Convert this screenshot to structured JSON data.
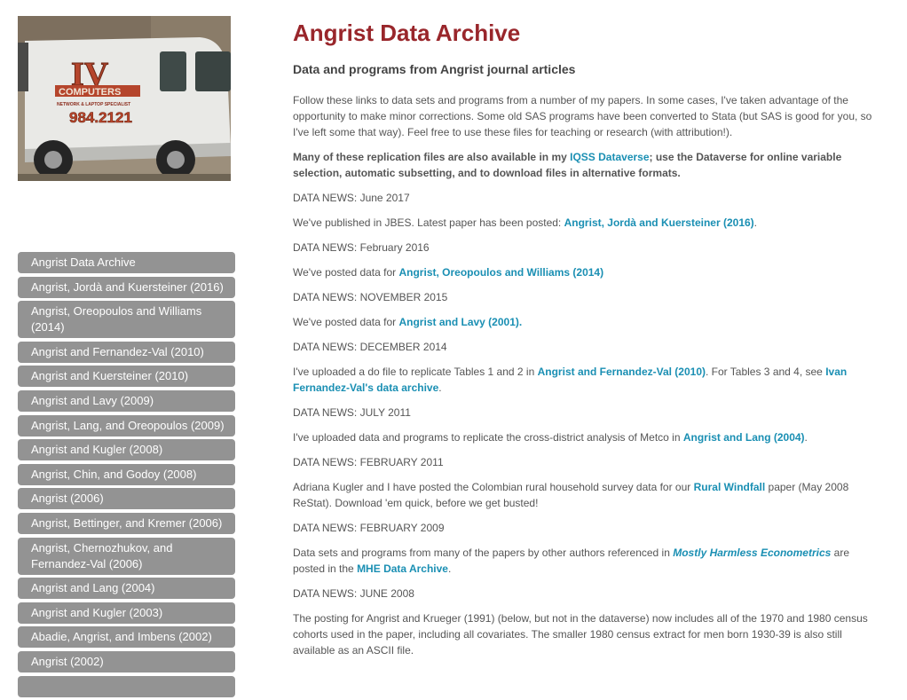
{
  "photo": {
    "van_logo": "IV",
    "van_brand": "COMPUTERS",
    "van_tagline": "NETWORK & LAPTOP SPECIALIST",
    "van_phone": "984.2121"
  },
  "sidebar": {
    "items": [
      "Angrist Data Archive",
      "Angrist, Jordà and Kuersteiner (2016)",
      "Angrist, Oreopoulos and Williams (2014)",
      "Angrist and Fernandez-Val (2010)",
      "Angrist and Kuersteiner (2010)",
      "Angrist and Lavy (2009)",
      "Angrist, Lang, and Oreopoulos (2009)",
      "Angrist and Kugler (2008)",
      "Angrist, Chin, and Godoy (2008)",
      "Angrist (2006)",
      "Angrist, Bettinger, and Kremer (2006)",
      "Angrist, Chernozhukov, and Fernandez-Val (2006)",
      "Angrist and Lang (2004)",
      "Angrist and Kugler (2003)",
      "Abadie, Angrist, and Imbens (2002)",
      "Angrist (2002)",
      ""
    ]
  },
  "main": {
    "title": "Angrist Data Archive",
    "subtitle": "Data and programs from Angrist journal articles",
    "intro": "Follow these links to data sets and programs from a number of my papers. In some cases, I've taken advantage of the opportunity to make minor corrections. Some old SAS programs have been converted to Stata (but SAS is good for you, so I've left some that way). Feel free to use these files for teaching or research (with attribution!).",
    "dataverse": {
      "before": "Many of these replication files are also available in my ",
      "link": "IQSS Dataverse",
      "after": "; use the Dataverse for online variable selection, automatic subsetting, and to download files in alternative formats."
    },
    "news": [
      {
        "heading": "DATA NEWS: June 2017",
        "parts": [
          {
            "t": "We've published in JBES. Latest paper has been posted: "
          },
          {
            "t": "Angrist, Jordà and Kuersteiner (2016)",
            "link": true
          },
          {
            "t": "."
          }
        ]
      },
      {
        "heading": "DATA NEWS: February 2016",
        "parts": [
          {
            "t": "We've posted data for "
          },
          {
            "t": "Angrist, Oreopoulos and Williams (2014)",
            "link": true
          }
        ]
      },
      {
        "heading": "DATA NEWS: NOVEMBER 2015",
        "parts": [
          {
            "t": "We've posted data for "
          },
          {
            "t": "Angrist and Lavy (2001).",
            "link": true
          }
        ]
      },
      {
        "heading": "DATA NEWS: DECEMBER 2014",
        "parts": [
          {
            "t": "I've uploaded a do file to replicate Tables 1 and 2 in "
          },
          {
            "t": "Angrist and Fernandez-Val (2010)",
            "link": true
          },
          {
            "t": ".  For Tables 3 and 4, see "
          },
          {
            "t": "Ivan Fernandez-Val's data archive",
            "link": true
          },
          {
            "t": "."
          }
        ]
      },
      {
        "heading": "DATA NEWS: JULY 2011",
        "parts": [
          {
            "t": "I've uploaded data and programs to replicate the cross-district analysis of Metco in "
          },
          {
            "t": "Angrist and Lang (2004)",
            "link": true
          },
          {
            "t": "."
          }
        ]
      },
      {
        "heading": "DATA NEWS: FEBRUARY 2011",
        "parts": [
          {
            "t": "Adriana Kugler and I have posted the Colombian rural household survey data for our "
          },
          {
            "t": "Rural Windfall",
            "link": true
          },
          {
            "t": " paper (May 2008 ReStat).  Download 'em quick, before we get busted!"
          }
        ]
      },
      {
        "heading": "DATA NEWS: FEBRUARY 2009",
        "parts": [
          {
            "t": "Data sets and programs from many of the papers by other authors referenced in "
          },
          {
            "t": "Mostly Harmless Econometrics",
            "link": true,
            "italic": true
          },
          {
            "t": " are posted in the "
          },
          {
            "t": "MHE Data Archive",
            "link": true
          },
          {
            "t": "."
          }
        ]
      },
      {
        "heading": "DATA NEWS: JUNE 2008",
        "parts": [
          {
            "t": "The posting for Angrist and Krueger (1991) (below, but not in the dataverse) now includes all of the 1970 and 1980 census cohorts used in the paper, including all covariates.  The smaller 1980 census extract for men born 1930-39 is also still available as an ASCII file."
          }
        ]
      }
    ]
  }
}
